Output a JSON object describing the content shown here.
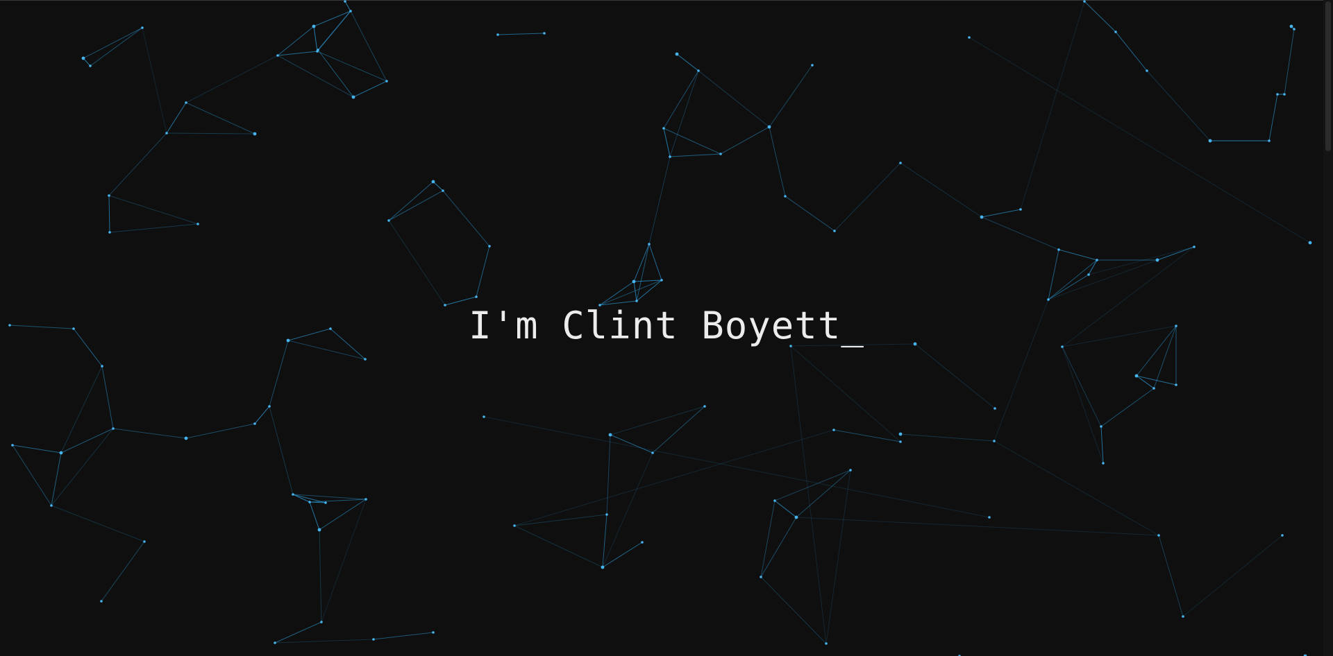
{
  "hero": {
    "greeting": "I'm Clint Boyett",
    "cursor": "_"
  },
  "background": {
    "type": "particle-network",
    "page_color": "#0f0f0f",
    "line_color": "#2a8fc6",
    "node_color": "#47b4ee",
    "text_color": "#ececec"
  }
}
